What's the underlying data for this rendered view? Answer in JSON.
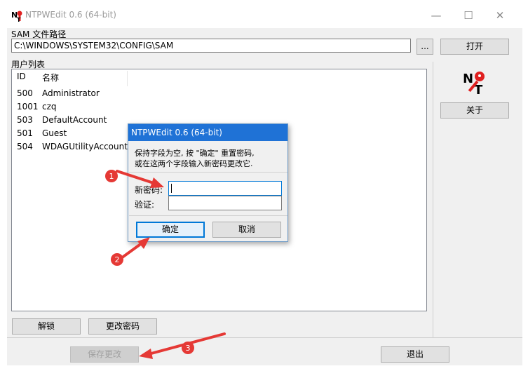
{
  "window": {
    "title": "NTPWEdit 0.6 (64-bit)",
    "controls": {
      "minimize": "—",
      "maximize": "☐",
      "close": "✕"
    }
  },
  "sam": {
    "label": "SAM 文件路径",
    "path": "C:\\WINDOWS\\SYSTEM32\\CONFIG\\SAM",
    "browse_label": "...",
    "open_label": "打开"
  },
  "user_list": {
    "label": "用户列表",
    "columns": [
      "ID",
      "名称"
    ],
    "rows": [
      {
        "id": "500",
        "name": "Administrator"
      },
      {
        "id": "1001",
        "name": "czq"
      },
      {
        "id": "503",
        "name": "DefaultAccount"
      },
      {
        "id": "501",
        "name": "Guest"
      },
      {
        "id": "504",
        "name": "WDAGUtilityAccount"
      }
    ]
  },
  "side": {
    "logo_text": "NT",
    "about_label": "关于"
  },
  "actions": {
    "unlock_label": "解锁",
    "change_password_label": "更改密码",
    "save_label": "保存更改",
    "exit_label": "退出"
  },
  "dialog": {
    "title": "NTPWEdit 0.6 (64-bit)",
    "message_line1": "保持字段为空, 按 \"确定\" 重置密码,",
    "message_line2": "或在这两个字段输入新密码更改它.",
    "new_password_label": "新密码:",
    "new_password_value": "",
    "verify_label": "验证:",
    "verify_value": "",
    "ok_label": "确定",
    "cancel_label": "取消"
  },
  "annotations": {
    "markers": [
      "1",
      "2",
      "3"
    ],
    "color": "#e53935"
  }
}
